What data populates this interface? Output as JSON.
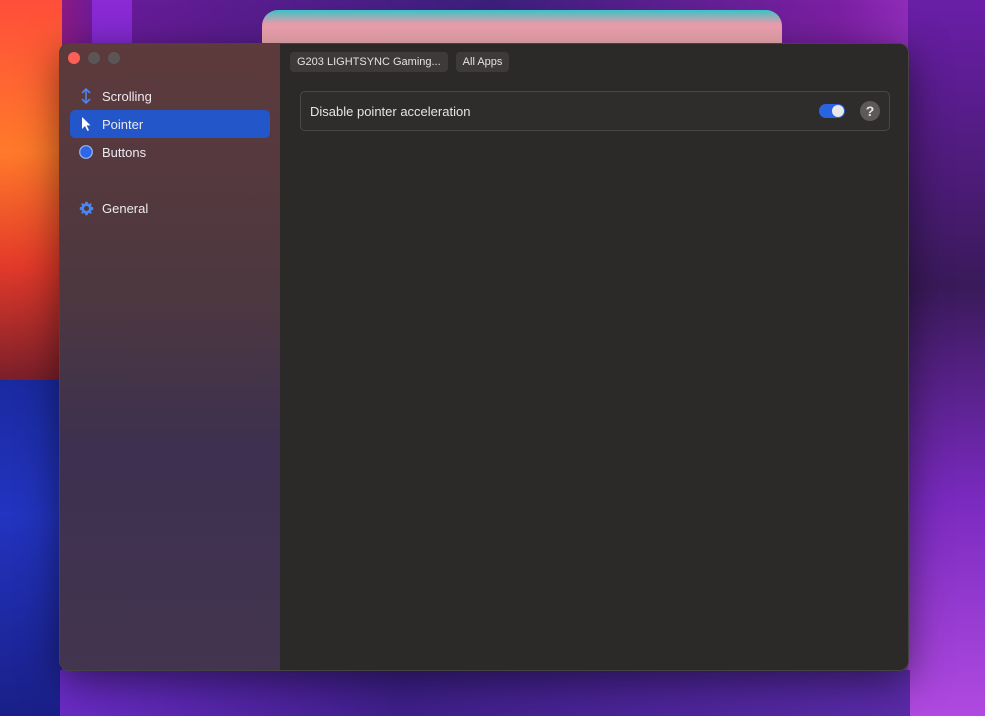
{
  "window": {
    "controls": [
      "close",
      "minimize",
      "maximize"
    ]
  },
  "sidebar": {
    "items": [
      {
        "label": "Scrolling",
        "icon": "arrow-up-down-icon",
        "active": false
      },
      {
        "label": "Pointer",
        "icon": "cursor-arrow-icon",
        "active": true
      },
      {
        "label": "Buttons",
        "icon": "circle-button-icon",
        "active": false
      },
      {
        "label": "General",
        "icon": "gear-icon",
        "active": false
      }
    ]
  },
  "toolbar": {
    "device": "G203 LIGHTSYNC Gaming...",
    "app_scope": "All Apps"
  },
  "settings": {
    "disable_accel_label": "Disable pointer acceleration",
    "disable_accel_enabled": true,
    "help_label": "?"
  },
  "colors": {
    "accent": "#2356c9",
    "toggle_on": "#2a64e0",
    "close": "#fe5f57"
  }
}
